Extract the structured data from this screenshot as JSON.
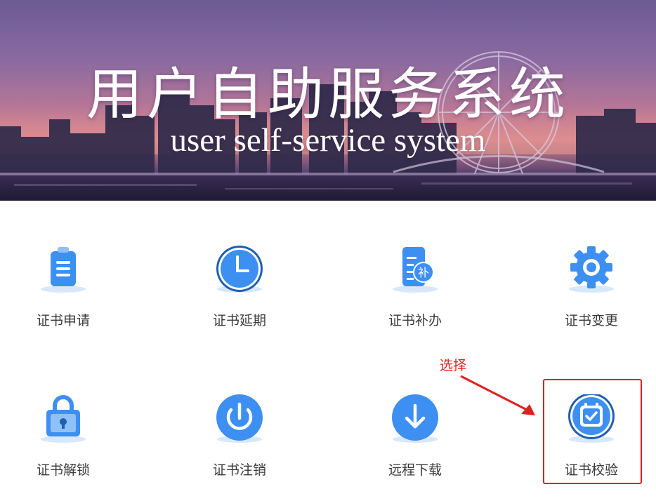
{
  "banner": {
    "title": "用户自助服务系统",
    "subtitle": "user self-service system"
  },
  "tiles": [
    {
      "label": "证书申请",
      "icon": "clipboard-list-icon"
    },
    {
      "label": "证书延期",
      "icon": "clock-icon"
    },
    {
      "label": "证书补办",
      "icon": "document-reissue-icon"
    },
    {
      "label": "证书变更",
      "icon": "gear-icon"
    },
    {
      "label": "证书解锁",
      "icon": "padlock-icon"
    },
    {
      "label": "证书注销",
      "icon": "power-icon"
    },
    {
      "label": "远程下载",
      "icon": "download-icon"
    },
    {
      "label": "证书校验",
      "icon": "calendar-check-icon"
    }
  ],
  "annotation": {
    "text": "选择",
    "color": "#e02020"
  },
  "colors": {
    "accent": "#3d8ff2",
    "label": "#3a3a3a"
  }
}
